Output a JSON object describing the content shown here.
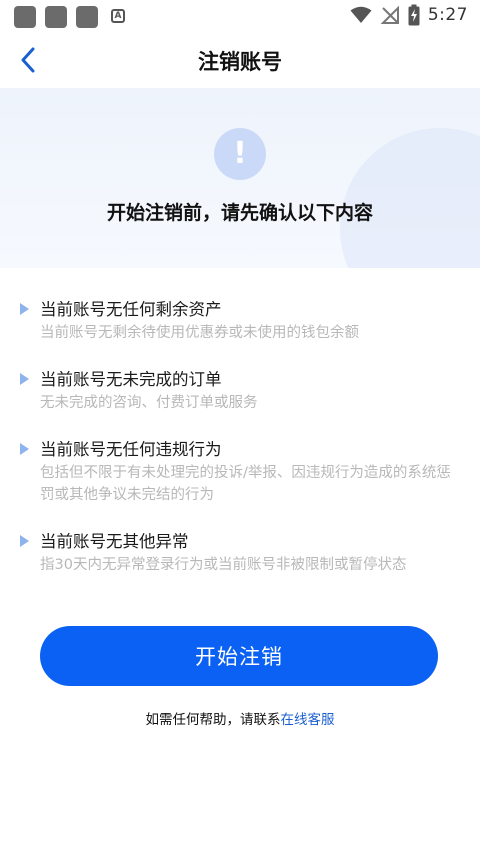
{
  "status_bar": {
    "time": "5:27",
    "left_icons": [
      "notification-square-icon",
      "notification-square-icon",
      "notification-square-icon",
      "a-box-icon"
    ],
    "right_icons": [
      "wifi-icon",
      "no-signal-icon",
      "battery-charging-icon"
    ],
    "a_box_label": "A"
  },
  "nav": {
    "title": "注销账号",
    "back_icon": "chevron-left-icon"
  },
  "banner": {
    "icon": "exclamation-icon",
    "icon_glyph": "!",
    "heading": "开始注销前，请先确认以下内容"
  },
  "conditions": [
    {
      "title": "当前账号无任何剩余资产",
      "desc": "当前账号无剩余待使用优惠券或未使用的钱包余额"
    },
    {
      "title": "当前账号无未完成的订单",
      "desc": "无未完成的咨询、付费订单或服务"
    },
    {
      "title": "当前账号无任何违规行为",
      "desc": "包括但不限于有未处理完的投诉/举报、因违规行为造成的系统惩罚或其他争议未完结的行为"
    },
    {
      "title": "当前账号无其他异常",
      "desc": "指30天内无异常登录行为或当前账号非被限制或暂停状态"
    }
  ],
  "actions": {
    "start_label": "开始注销"
  },
  "help": {
    "prefix": "如需任何帮助，请联系",
    "link": "在线客服"
  },
  "colors": {
    "primary": "#0b61f4",
    "link": "#1a5fd0",
    "muted_text": "#b8b8b8",
    "arrow": "#8fb3ef",
    "banner_bg": "#eef3fc"
  }
}
